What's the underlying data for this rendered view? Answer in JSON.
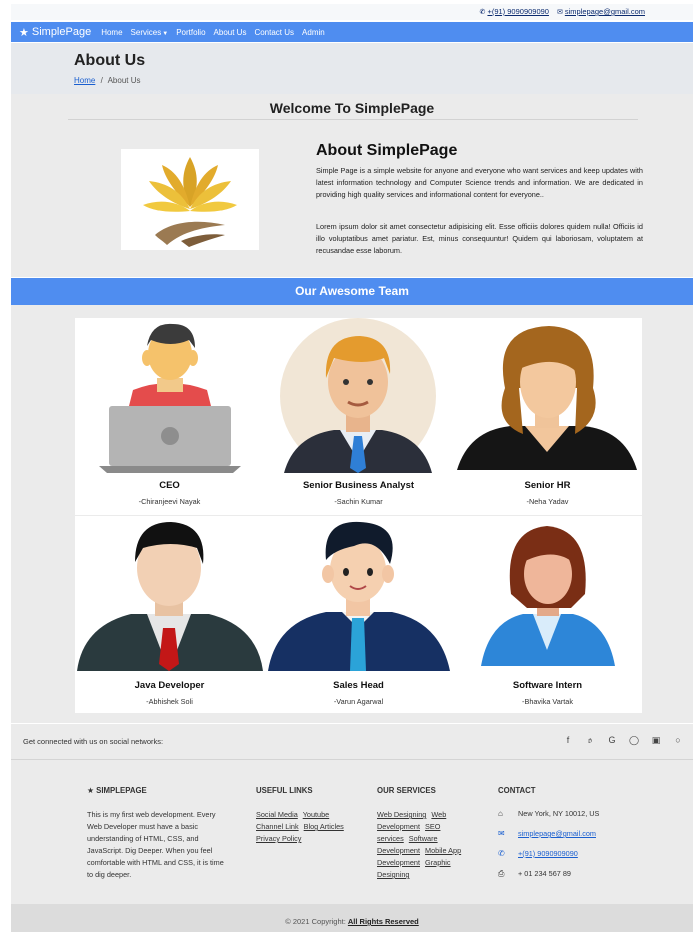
{
  "topbar": {
    "phone": "+(91) 9090909090",
    "email": "simplepage@gmail.com"
  },
  "navbar": {
    "brand": "SimplePage",
    "items": [
      "Home",
      "Services",
      "Portfolio",
      "About Us",
      "Contact Us",
      "Admin"
    ]
  },
  "page_header": {
    "title": "About Us",
    "breadcrumb_home": "Home",
    "breadcrumb_sep": "/",
    "breadcrumb_current": "About Us"
  },
  "about": {
    "welcome": "Welcome To SimplePage",
    "heading": "About SimplePage",
    "para1": "Simple Page is a simple website for anyone and everyone who want services and keep updates with latest information technology and Computer Science trends and information. We are dedicated in providing high quality services and informational content for everyone..",
    "para2": "Lorem ipsum dolor sit amet consectetur adipisicing elit. Esse officiis dolores quidem nulla! Officiis id illo voluptatibus amet pariatur. Est, minus consequuntur! Quidem qui laboriosam, voluptatem at recusandae esse laborum."
  },
  "team": {
    "title": "Our Awesome Team",
    "members": [
      {
        "role": "CEO",
        "name": "-Chiranjeevi Nayak"
      },
      {
        "role": "Senior Business Analyst",
        "name": "-Sachin Kumar"
      },
      {
        "role": "Senior HR",
        "name": "-Neha Yadav"
      },
      {
        "role": "Java Developer",
        "name": "-Abhishek Soli"
      },
      {
        "role": "Sales Head",
        "name": "-Varun Agarwal"
      },
      {
        "role": "Software Intern",
        "name": "-Bhavika Vartak"
      }
    ]
  },
  "social": {
    "text": "Get connected with us on social networks:",
    "icons": [
      "facebook-icon",
      "twitter-icon",
      "google-icon",
      "instagram-icon",
      "linkedin-icon",
      "github-icon"
    ]
  },
  "footer": {
    "brand": "SIMPLEPAGE",
    "brand_text": "This is my first web development. Every Web Developer must have a basic understanding of HTML, CSS, and JavaScript. Dig Deeper. When you feel comfortable with HTML and CSS, it is time to dig deeper.",
    "useful_links_title": "USEFUL LINKS",
    "useful_links": [
      "Social Media",
      "Youtube Channel Link",
      "Blog Articles",
      "Privacy Policy"
    ],
    "services_title": "OUR SERVICES",
    "services": [
      "Web Designing",
      "Web Development",
      "SEO services",
      "Software Development",
      "Mobile App Development",
      "Graphic Designing"
    ],
    "contact_title": "CONTACT",
    "address": "New York, NY 10012, US",
    "email": "simplepage@gmail.com",
    "phone": "+(91) 9090909090",
    "fax": "+ 01 234 567 89"
  },
  "copyright": {
    "text": "© 2021 Copyright:",
    "link": "All Rights Reserved"
  },
  "colors": {
    "accent": "#4f8df0",
    "link": "#1a5fd0"
  }
}
